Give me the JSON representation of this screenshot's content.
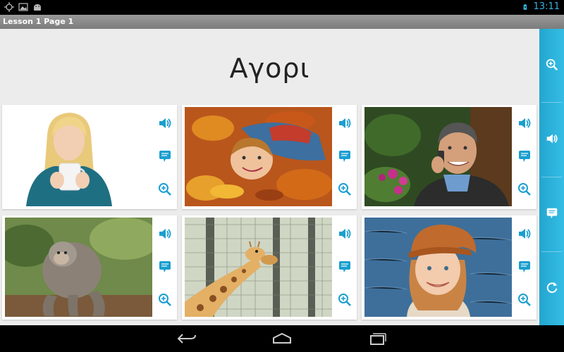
{
  "status_bar": {
    "time": "13:11",
    "icons": [
      "crosshair-icon",
      "image-icon",
      "android-icon",
      "battery-charging-icon"
    ]
  },
  "title_bar": {
    "title": "Lesson 1 Page 1"
  },
  "lesson": {
    "word": "Αγορι",
    "cards": [
      {
        "photo": "woman-with-mug",
        "actions": [
          "speaker-icon",
          "speech-bubble-icon",
          "zoom-in-icon"
        ]
      },
      {
        "photo": "boy-in-autumn-leaves",
        "actions": [
          "speaker-icon",
          "speech-bubble-icon",
          "zoom-in-icon"
        ]
      },
      {
        "photo": "man-on-phone",
        "actions": [
          "speaker-icon",
          "speech-bubble-icon",
          "zoom-in-icon"
        ]
      },
      {
        "photo": "monkey",
        "actions": [
          "speaker-icon",
          "speech-bubble-icon",
          "zoom-in-icon"
        ]
      },
      {
        "photo": "giraffe",
        "actions": [
          "speaker-icon",
          "speech-bubble-icon",
          "zoom-in-icon"
        ]
      },
      {
        "photo": "girl-with-cap",
        "actions": [
          "speaker-icon",
          "speech-bubble-icon",
          "zoom-in-icon"
        ]
      }
    ]
  },
  "sidebar": {
    "buttons": [
      "zoom-in-icon",
      "speaker-icon",
      "speech-bubble-icon",
      "refresh-icon"
    ]
  },
  "nav_bar": {
    "buttons": [
      "back-icon",
      "home-icon",
      "recent-apps-icon"
    ]
  },
  "colors": {
    "accent": "#33b5e5",
    "sidebar": "#2bb0dc",
    "icon_blue": "#1a9fd0",
    "background": "#ececec"
  }
}
